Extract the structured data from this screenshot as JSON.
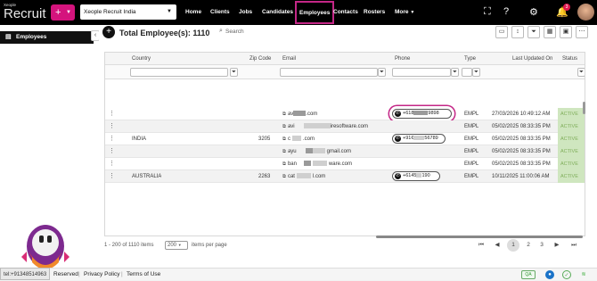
{
  "brand": {
    "small": "Xeople",
    "name": "Recruit"
  },
  "tenant": {
    "name": "Xeople Recruit India"
  },
  "nav": [
    {
      "label": "Home"
    },
    {
      "label": "Clients"
    },
    {
      "label": "Jobs"
    },
    {
      "label": "Candidates"
    },
    {
      "label": "Employees"
    },
    {
      "label": "Contacts"
    },
    {
      "label": "Rosters"
    },
    {
      "label": "More"
    }
  ],
  "notifications": {
    "count": "3"
  },
  "sidebar": {
    "item": "Employees"
  },
  "header": {
    "title": "Total Employee(s): 1110",
    "search_placeholder": "Search"
  },
  "table": {
    "columns": [
      "Country",
      "Zip Code",
      "Email",
      "Phone",
      "Type",
      "Last Updated On",
      "Status"
    ],
    "rows": [
      {
        "country": "",
        "zip": "",
        "email_a": "av",
        "email_b": ".com",
        "phone_a": "+618",
        "phone_b": "9898",
        "type": "EMPL",
        "updated": "27/03/2026 10:49:12 AM",
        "status": "ACTIVE"
      },
      {
        "country": "",
        "zip": "",
        "email_a": "avi",
        "email_b": "iresoftware.com",
        "phone_a": "",
        "phone_b": "",
        "type": "EMPL",
        "updated": "05/02/2025 08:33:35 PM",
        "status": "ACTIVE"
      },
      {
        "country": "INDIA",
        "zip": "3205",
        "email_a": "c",
        "email_b": ".com",
        "phone_a": "+91€",
        "phone_b": "56789",
        "type": "EMPL",
        "updated": "05/02/2025 08:33:35 PM",
        "status": "ACTIVE"
      },
      {
        "country": "",
        "zip": "",
        "email_a": "ayu",
        "email_b": "gmail.com",
        "phone_a": "",
        "phone_b": "",
        "type": "EMPL",
        "updated": "05/02/2025 08:33:35 PM",
        "status": "ACTIVE"
      },
      {
        "country": "",
        "zip": "",
        "email_a": "ban",
        "email_b": "ware.com",
        "phone_a": "",
        "phone_b": "",
        "type": "EMPL",
        "updated": "05/02/2025 08:33:35 PM",
        "status": "ACTIVE"
      },
      {
        "country": "AUSTRALIA",
        "zip": "2263",
        "email_a": "cat",
        "email_b": "l.com",
        "phone_a": "+6145",
        "phone_b": "190",
        "type": "EMPL",
        "updated": "10/11/2025 11:00:06 AM",
        "status": "ACTIVE"
      }
    ]
  },
  "pager": {
    "range": "1 - 200 of 1110 items",
    "per_page": "200",
    "per_page_label": "items per page",
    "pages": [
      "1",
      "2",
      "3"
    ],
    "current": "1"
  },
  "footer": {
    "reserved": "Reserved",
    "privacy": "Privacy Policy",
    "terms": "Terms of Use",
    "qa": "QA",
    "sep": "|",
    "tel": "tel:+91348514963"
  },
  "colors": {
    "accent": "#d4147d",
    "highlight": "#c42787",
    "status_bg": "#cfe6bf"
  }
}
